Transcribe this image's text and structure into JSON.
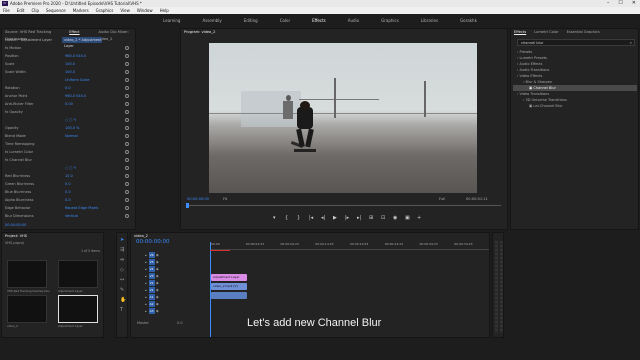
{
  "app": {
    "title": "Adobe Premiere Pro 2020 - D:\\Untitled Episode\\VHS Tutorial\\VHS *",
    "logo": "Pr",
    "window_controls": [
      "–",
      "☐",
      "✕"
    ]
  },
  "menu": [
    "File",
    "Edit",
    "Clip",
    "Sequence",
    "Markers",
    "Graphics",
    "View",
    "Window",
    "Help"
  ],
  "workspaces": {
    "items": [
      "Learning",
      "Assembly",
      "Editing",
      "Color",
      "Effects",
      "Audio",
      "Graphics",
      "Libraries",
      "Gorakhk"
    ],
    "active_index": 4
  },
  "effect_controls": {
    "tabs": [
      "Source: VHS Red Tracking Overlay.mov",
      "Effect Controls",
      "Audio Clip Mixer: video_2"
    ],
    "active_tab": 1,
    "header_left": "Master * Adjustment Layer",
    "header_right": "video_2 * Adjustment Layer",
    "rows": [
      {
        "label": "fx  Motion",
        "value": ""
      },
      {
        "label": "    Position",
        "value": "960.0    540.0"
      },
      {
        "label": "    Scale",
        "value": "100.0"
      },
      {
        "label": "    Scale Width",
        "value": "100.0"
      },
      {
        "label": "",
        "value": "Uniform Scale"
      },
      {
        "label": "    Rotation",
        "value": "0.0"
      },
      {
        "label": "    Anchor Point",
        "value": "960.0    540.0"
      },
      {
        "label": "    Anti-flicker Filter",
        "value": "0.00"
      },
      {
        "label": "fx  Opacity",
        "value": ""
      },
      {
        "label": "",
        "value": "○ ▢ ✎"
      },
      {
        "label": "    Opacity",
        "value": "100.0 %"
      },
      {
        "label": "    Blend Mode",
        "value": "Normal"
      },
      {
        "label": "  Time Remapping",
        "value": ""
      },
      {
        "label": "fx  Lumetri Color",
        "value": ""
      },
      {
        "label": "fx  Channel Blur",
        "value": ""
      },
      {
        "label": "",
        "value": "○ ▢ ✎"
      },
      {
        "label": "    Red Blurriness",
        "value": "10.0"
      },
      {
        "label": "    Green Blurriness",
        "value": "0.0"
      },
      {
        "label": "    Blue Blurriness",
        "value": "0.0"
      },
      {
        "label": "    Alpha Blurriness",
        "value": "0.0"
      },
      {
        "label": "    Edge Behavior",
        "value": "Repeat Edge Pixels"
      },
      {
        "label": "    Blur Dimensions",
        "value": "Vertical"
      }
    ],
    "timecode": "00:00:00:00"
  },
  "program": {
    "tab": "Program: video_2",
    "timecode_left": "00:00:00:00",
    "fit": "Fit",
    "quality": "Full",
    "timecode_right": "00:00:01:11",
    "controls": [
      "▾",
      "{",
      "}",
      "|◂",
      "◂|",
      "▶",
      "|▸",
      "▸|",
      "⊞",
      "⊡",
      "◉",
      "▣",
      "+"
    ]
  },
  "effects": {
    "tabs": [
      "Effects",
      "Lumetri Color",
      "Essential Graphics"
    ],
    "active_tab": 0,
    "search_value": "channel blur",
    "tree": [
      {
        "label": "Presets",
        "level": 0
      },
      {
        "label": "Lumetri Presets",
        "level": 0
      },
      {
        "label": "Audio Effects",
        "level": 0
      },
      {
        "label": "Audio Transitions",
        "level": 0
      },
      {
        "label": "Video Effects",
        "level": 0
      },
      {
        "label": "Blur & Sharpen",
        "level": 1
      },
      {
        "label": "Channel Blur",
        "level": 2,
        "selected": true
      },
      {
        "label": "Video Transitions",
        "level": 0
      },
      {
        "label": "3D Universe Transitions",
        "level": 1
      },
      {
        "label": "uni.Channel Blur",
        "level": 2
      }
    ]
  },
  "project": {
    "tab": "Project: VHS",
    "file": "VHS.prproj",
    "count": "1 of 5 items",
    "items": [
      {
        "name": "VHS Red Tracking Overlay.mov",
        "duration": "0:06"
      },
      {
        "name": "Adjustment Layer",
        "duration": "0:00"
      },
      {
        "name": "video_2",
        "duration": "1:11"
      },
      {
        "name": "Adjustment Layer",
        "duration": ""
      }
    ]
  },
  "timeline": {
    "tab": "video_2",
    "timecode": "00:00:00:00",
    "ruler": [
      "00:00",
      "00:00:04:23",
      "00:00:09:23",
      "00:00:14:23",
      "00:00:19:23",
      "00:00:24:23",
      "00:00:29:23",
      "00:00:34:23"
    ],
    "tracks": [
      "V6",
      "V5",
      "V4",
      "V3",
      "V2",
      "V1",
      "A1",
      "A2",
      "A3"
    ],
    "master": "Master",
    "master_value": "0.0",
    "clips": [
      {
        "name": "Adjustment Layer",
        "color": "#d98be6"
      },
      {
        "name": "video_2.mp4 [V]",
        "color": "#6f8fd6"
      },
      {
        "name": "",
        "color": "#5a7fc0"
      }
    ]
  },
  "subtitle": "Let’s add new Channel Blur"
}
